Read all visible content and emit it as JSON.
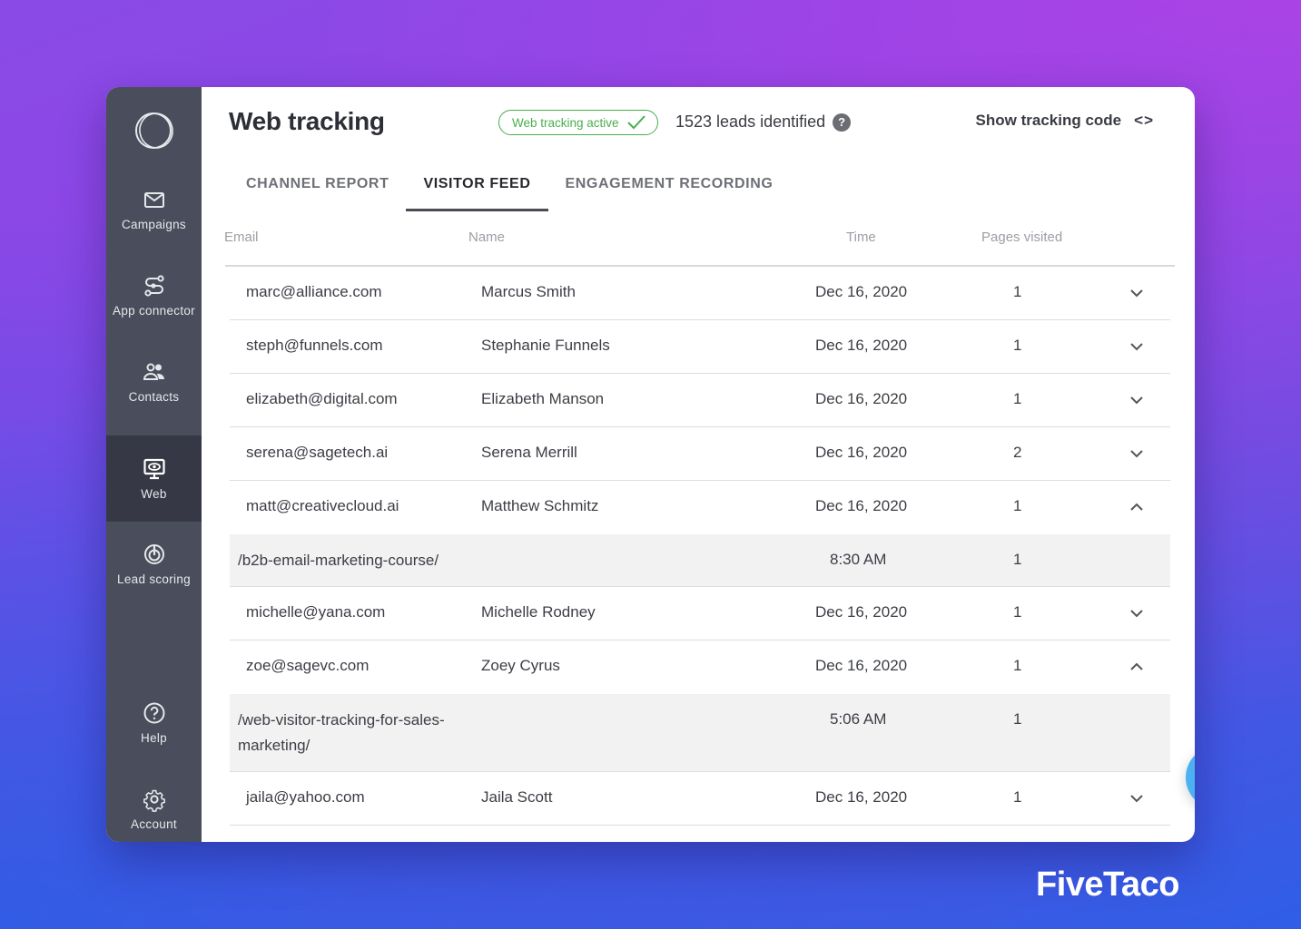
{
  "sidebar": {
    "logo": "logo-rings",
    "items": [
      {
        "label": "Campaigns",
        "icon": "mail-icon",
        "active": false
      },
      {
        "label": "App connector",
        "icon": "connector-icon",
        "active": false
      },
      {
        "label": "Contacts",
        "icon": "contacts-icon",
        "active": false
      },
      {
        "label": "Web",
        "icon": "monitor-eye-icon",
        "active": true
      },
      {
        "label": "Lead scoring",
        "icon": "target-icon",
        "active": false
      },
      {
        "label": "Help",
        "icon": "help-icon",
        "active": false
      },
      {
        "label": "Account",
        "icon": "gear-icon",
        "active": false
      }
    ]
  },
  "header": {
    "title": "Web tracking",
    "status_badge": "Web tracking active",
    "leads_text": "1523 leads identified",
    "help_glyph": "?",
    "show_code_label": "Show tracking code",
    "code_icon": "<>"
  },
  "tabs": [
    {
      "label": "CHANNEL REPORT",
      "active": false
    },
    {
      "label": "VISITOR FEED",
      "active": true
    },
    {
      "label": "ENGAGEMENT RECORDING",
      "active": false
    }
  ],
  "table": {
    "columns": [
      "Email",
      "Name",
      "Time",
      "Pages visited"
    ],
    "rows": [
      {
        "email": "marc@alliance.com",
        "name": "Marcus Smith",
        "time": "Dec 16, 2020",
        "pages": "1",
        "expanded": false
      },
      {
        "email": "steph@funnels.com",
        "name": "Stephanie Funnels",
        "time": "Dec 16, 2020",
        "pages": "1",
        "expanded": false
      },
      {
        "email": "elizabeth@digital.com",
        "name": "Elizabeth Manson",
        "time": "Dec 16, 2020",
        "pages": "1",
        "expanded": false
      },
      {
        "email": "serena@sagetech.ai",
        "name": "Serena Merrill",
        "time": "Dec 16, 2020",
        "pages": "2",
        "expanded": false
      },
      {
        "email": "matt@creativecloud.ai",
        "name": "Matthew Schmitz",
        "time": "Dec 16, 2020",
        "pages": "1",
        "expanded": true,
        "detail": {
          "path": "/b2b-email-marketing-course/",
          "time": "8:30 AM",
          "pages": "1"
        }
      },
      {
        "email": "michelle@yana.com",
        "name": "Michelle Rodney",
        "time": "Dec 16, 2020",
        "pages": "1",
        "expanded": false
      },
      {
        "email": "zoe@sagevc.com",
        "name": "Zoey Cyrus",
        "time": "Dec 16, 2020",
        "pages": "1",
        "expanded": true,
        "detail": {
          "path": "/web-visitor-tracking-for-sales-marketing/",
          "time": "5:06 AM",
          "pages": "1"
        }
      },
      {
        "email": "jaila@yahoo.com",
        "name": "Jaila Scott",
        "time": "Dec 16, 2020",
        "pages": "1",
        "expanded": false
      }
    ]
  },
  "chat_widget": {
    "icon": "chat-icon"
  },
  "brand": "FiveTaco",
  "colors": {
    "accent_green": "#4aae4f",
    "sidebar_bg": "#4a4e5c",
    "sidebar_active": "#363945",
    "chat_blue": "#4cb1f0"
  }
}
